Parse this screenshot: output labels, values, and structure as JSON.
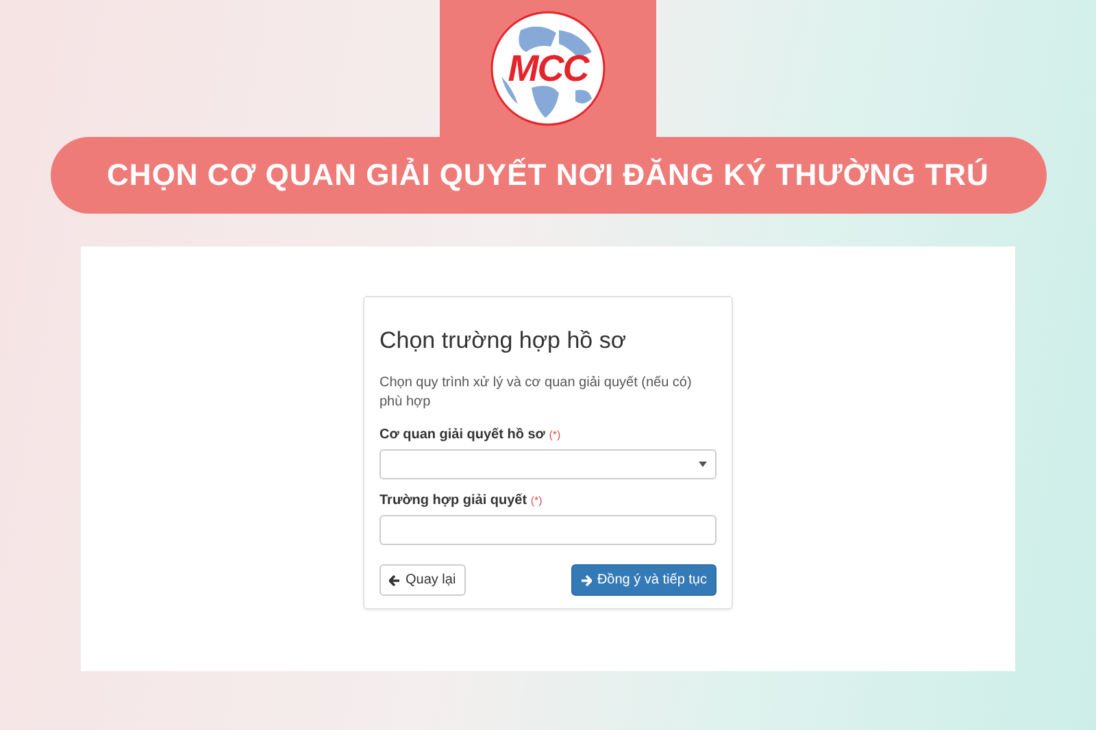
{
  "logo": {
    "text": "MCC"
  },
  "banner": {
    "title": "CHỌN CƠ QUAN GIẢI QUYẾT NƠI ĐĂNG KÝ THƯỜNG TRÚ"
  },
  "form": {
    "title": "Chọn trường hợp hồ sơ",
    "description": "Chọn quy trình xử lý và cơ quan giải quyết (nếu có) phù hợp",
    "fields": [
      {
        "kind": "select",
        "label": "Cơ quan giải quyết hồ sơ",
        "required_mark": "(*)"
      },
      {
        "kind": "text",
        "label": "Trường hợp giải quyết",
        "required_mark": "(*)"
      }
    ],
    "buttons": [
      {
        "kind": "back",
        "label": "Quay lại"
      },
      {
        "kind": "primary",
        "label": "Đồng ý và tiếp tục"
      }
    ]
  }
}
